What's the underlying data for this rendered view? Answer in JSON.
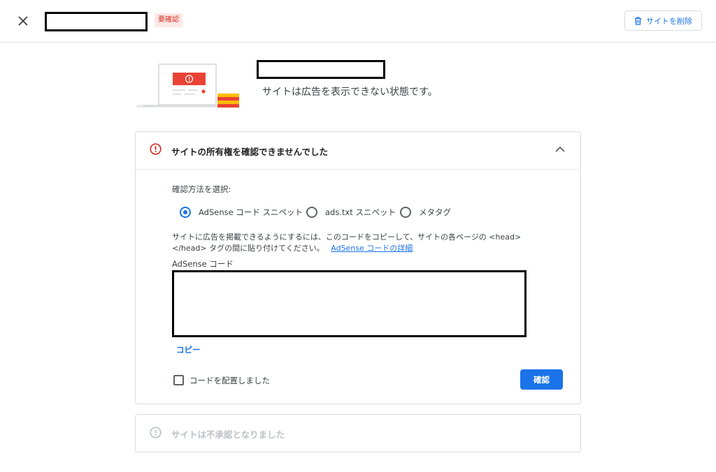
{
  "header": {
    "status_badge": "要確認",
    "delete_label": "サイトを削除"
  },
  "hero": {
    "status_text": "サイトは広告を表示できない状態です。"
  },
  "panel_verify": {
    "title": "サイトの所有権を確認できませんでした",
    "method_label": "確認方法を選択:",
    "options": [
      {
        "label": "AdSense コード スニペット",
        "selected": true
      },
      {
        "label": "ads.txt スニペット",
        "selected": false
      },
      {
        "label": "メタタグ",
        "selected": false
      }
    ],
    "instructions_line1": "サイトに広告を掲載できるようにするには、このコードをコピーして、サイトの各ページの <head>",
    "instructions_line2": "</head> タグの間に貼り付けてください。",
    "details_link": "AdSense コードの詳細",
    "code_label": "AdSense コード",
    "copy_label": "コピー",
    "checkbox_label": "コードを配置しました",
    "checkbox_checked": false,
    "confirm_label": "確認"
  },
  "panel_disapproved": {
    "title": "サイトは不承認となりました"
  },
  "colors": {
    "accent": "#1a73e8",
    "error": "#d93025",
    "badge_bg": "#fce8e6",
    "border": "#dadce0"
  }
}
